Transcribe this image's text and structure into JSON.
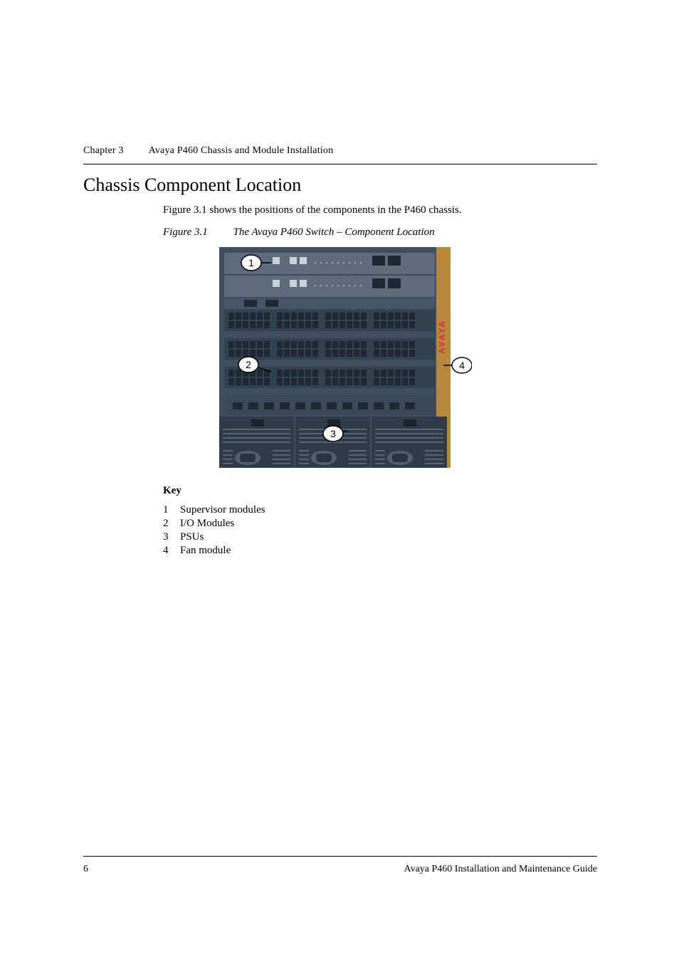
{
  "header": {
    "chapter_label": "Chapter 3",
    "chapter_title": "Avaya P460 Chassis and Module Installation"
  },
  "section_title": "Chassis Component Location",
  "intro_text": "Figure 3.1 shows the positions of the components in the P460 chassis.",
  "figure": {
    "label": "Figure 3.1",
    "title": "The Avaya P460 Switch – Component Location",
    "callouts": {
      "c1": "1",
      "c2": "2",
      "c3": "3",
      "c4": "4"
    },
    "brand": "AVAYA"
  },
  "key": {
    "heading": "Key",
    "items": [
      {
        "num": "1",
        "label": "Supervisor modules"
      },
      {
        "num": "2",
        "label": "I/O Modules"
      },
      {
        "num": "3",
        "label": "PSUs"
      },
      {
        "num": "4",
        "label": "Fan module"
      }
    ]
  },
  "footer": {
    "page_number": "6",
    "doc_title": "Avaya P460 Installation and Maintenance Guide"
  }
}
